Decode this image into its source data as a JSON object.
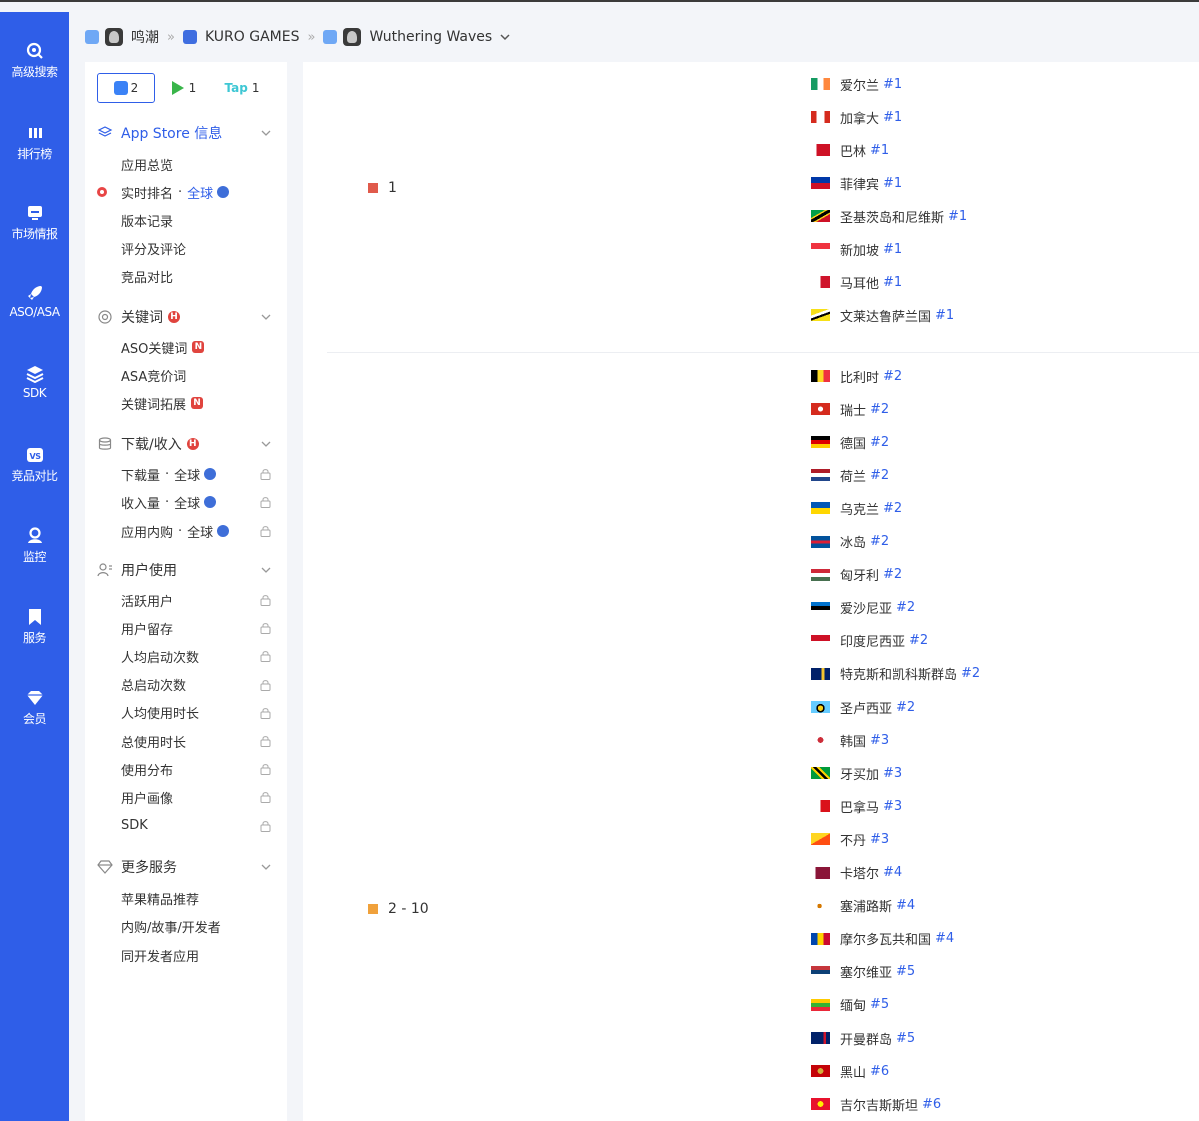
{
  "nav": {
    "items": [
      {
        "label": "高级搜索",
        "icon": "search-icon"
      },
      {
        "label": "排行榜",
        "icon": "bar-chart-icon"
      },
      {
        "label": "市场情报",
        "icon": "monitor-icon"
      },
      {
        "label": "ASO/ASA",
        "icon": "rocket-icon"
      },
      {
        "label": "SDK",
        "icon": "layers-icon"
      },
      {
        "label": "竞品对比",
        "icon": "vs-icon"
      },
      {
        "label": "监控",
        "icon": "monitor-person-icon"
      },
      {
        "label": "服务",
        "icon": "bookmark-icon"
      },
      {
        "label": "会员",
        "icon": "diamond-icon"
      }
    ]
  },
  "breadcrumb": {
    "developer": "鸣潮",
    "publisher": "KURO GAMES",
    "app": "Wuthering Waves",
    "separator": "»"
  },
  "store_tabs": [
    {
      "count": "2",
      "store": "appstore"
    },
    {
      "count": "1",
      "store": "googleplay"
    },
    {
      "label": "Tap",
      "count": "1",
      "store": "taptap"
    }
  ],
  "sidebar": {
    "appstore": {
      "title": "App Store 信息",
      "items": {
        "overview": "应用总览",
        "realtime": "实时排名",
        "realtime_scope": "全球",
        "versions": "版本记录",
        "reviews": "评分及评论",
        "compare": "竞品对比"
      }
    },
    "keywords": {
      "title": "关键词",
      "badge": "H",
      "items": {
        "aso": "ASO关键词",
        "asa": "ASA竞价词",
        "expand": "关键词拓展",
        "new_badge": "N"
      }
    },
    "downloads": {
      "title": "下载/收入",
      "badge": "H",
      "items": {
        "downloads": "下载量",
        "revenue": "收入量",
        "iap": "应用内购",
        "scope": "全球"
      }
    },
    "usage": {
      "title": "用户使用",
      "items": [
        "活跃用户",
        "用户留存",
        "人均启动次数",
        "总启动次数",
        "人均使用时长",
        "总使用时长",
        "使用分布",
        "用户画像",
        "SDK"
      ]
    },
    "more": {
      "title": "更多服务",
      "items": [
        "苹果精品推荐",
        "内购/故事/开发者",
        "同开发者应用"
      ]
    }
  },
  "groups": [
    {
      "label": "1",
      "color": "#e05a4b"
    },
    {
      "label": "2 - 10",
      "color": "#f0a13b"
    }
  ],
  "rankings": [
    {
      "country": "爱尔兰",
      "rank": "#1",
      "flag": "flag-ireland"
    },
    {
      "country": "加拿大",
      "rank": "#1",
      "flag": "flag-canada"
    },
    {
      "country": "巴林",
      "rank": "#1",
      "flag": "flag-bahrain"
    },
    {
      "country": "菲律宾",
      "rank": "#1",
      "flag": "flag-philippines"
    },
    {
      "country": "圣基茨岛和尼维斯",
      "rank": "#1",
      "flag": "flag-saint-kitts"
    },
    {
      "country": "新加坡",
      "rank": "#1",
      "flag": "flag-singapore"
    },
    {
      "country": "马耳他",
      "rank": "#1",
      "flag": "flag-malta"
    },
    {
      "country": "文莱达鲁萨兰国",
      "rank": "#1",
      "flag": "flag-brunei"
    },
    {
      "country": "比利时",
      "rank": "#2",
      "flag": "flag-belgium"
    },
    {
      "country": "瑞士",
      "rank": "#2",
      "flag": "flag-switzerland"
    },
    {
      "country": "德国",
      "rank": "#2",
      "flag": "flag-germany"
    },
    {
      "country": "荷兰",
      "rank": "#2",
      "flag": "flag-netherlands"
    },
    {
      "country": "乌克兰",
      "rank": "#2",
      "flag": "flag-ukraine"
    },
    {
      "country": "冰岛",
      "rank": "#2",
      "flag": "flag-iceland"
    },
    {
      "country": "匈牙利",
      "rank": "#2",
      "flag": "flag-hungary"
    },
    {
      "country": "爱沙尼亚",
      "rank": "#2",
      "flag": "flag-estonia"
    },
    {
      "country": "印度尼西亚",
      "rank": "#2",
      "flag": "flag-indonesia"
    },
    {
      "country": "特克斯和凯科斯群岛",
      "rank": "#2",
      "flag": "flag-turks-caicos"
    },
    {
      "country": "圣卢西亚",
      "rank": "#2",
      "flag": "flag-saint-lucia"
    },
    {
      "country": "韩国",
      "rank": "#3",
      "flag": "flag-korea"
    },
    {
      "country": "牙买加",
      "rank": "#3",
      "flag": "flag-jamaica"
    },
    {
      "country": "巴拿马",
      "rank": "#3",
      "flag": "flag-panama"
    },
    {
      "country": "不丹",
      "rank": "#3",
      "flag": "flag-bhutan"
    },
    {
      "country": "卡塔尔",
      "rank": "#4",
      "flag": "flag-qatar"
    },
    {
      "country": "塞浦路斯",
      "rank": "#4",
      "flag": "flag-cyprus"
    },
    {
      "country": "摩尔多瓦共和国",
      "rank": "#4",
      "flag": "flag-moldova"
    },
    {
      "country": "塞尔维亚",
      "rank": "#5",
      "flag": "flag-serbia"
    },
    {
      "country": "缅甸",
      "rank": "#5",
      "flag": "flag-myanmar"
    },
    {
      "country": "开曼群岛",
      "rank": "#5",
      "flag": "flag-cayman"
    },
    {
      "country": "黑山",
      "rank": "#6",
      "flag": "flag-montenegro"
    },
    {
      "country": "吉尔吉斯斯坦",
      "rank": "#6",
      "flag": "flag-kyrgyzstan"
    }
  ],
  "colors": {
    "brand": "#2f5ee8",
    "rank_text": "#2f5ee8",
    "badge": "#e0443e"
  }
}
